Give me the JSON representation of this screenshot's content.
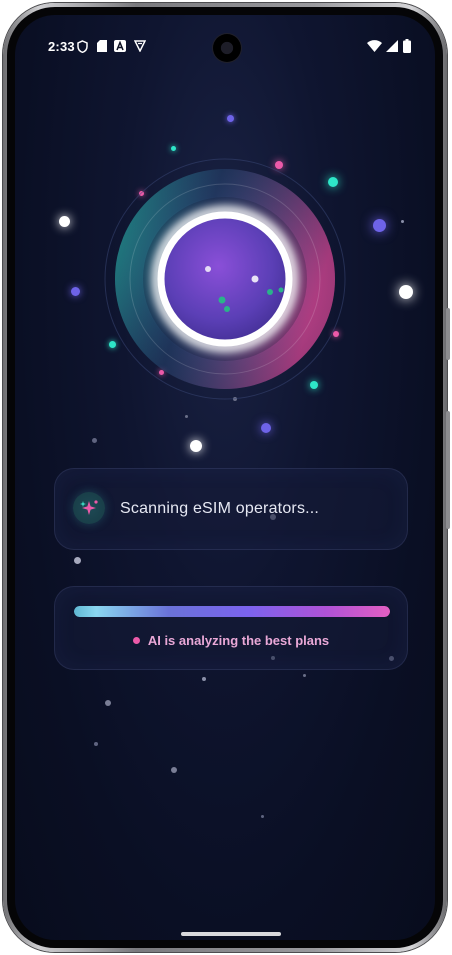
{
  "status_bar": {
    "time": "2:33",
    "left_icons": [
      "shield-icon",
      "sd-card-icon",
      "app-a-icon",
      "download-shield-icon"
    ],
    "right_icons": [
      "wifi-icon",
      "signal-icon",
      "battery-icon"
    ]
  },
  "scan_card": {
    "icon": "sparkle-icon",
    "text": "Scanning eSIM operators..."
  },
  "progress_card": {
    "progress": 1.0,
    "status_text": "AI is analyzing the best plans"
  },
  "colors": {
    "background": "#0a0f24",
    "accent_teal": "#2ee6c8",
    "accent_pink": "#ec5aa9",
    "accent_purple": "#7b63ee"
  }
}
